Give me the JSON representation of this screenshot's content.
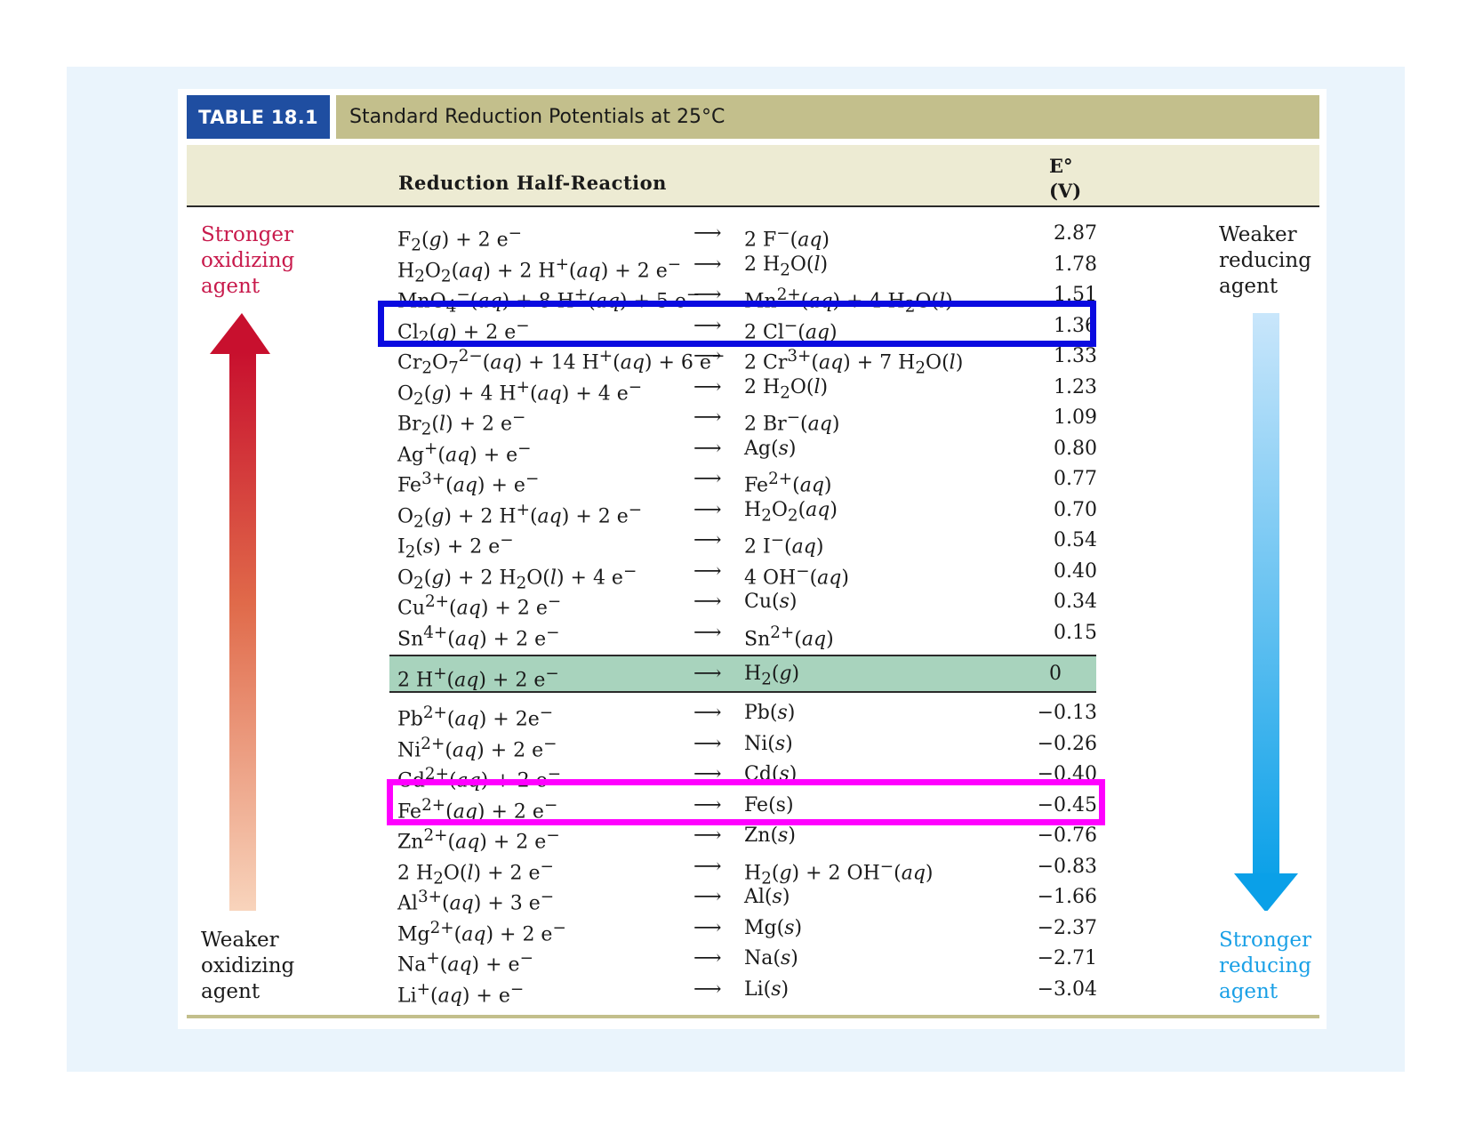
{
  "table": {
    "tag": "TABLE 18.1",
    "title": "Standard Reduction Potentials at 25°C",
    "col_reaction": "Reduction Half-Reaction",
    "col_potential_symbol": "E°",
    "col_potential_unit": "(V)"
  },
  "labels": {
    "left_top": [
      "Stronger",
      "oxidizing",
      "agent"
    ],
    "left_bottom": [
      "Weaker",
      "oxidizing",
      "agent"
    ],
    "right_top": [
      "Weaker",
      "reducing",
      "agent"
    ],
    "right_bottom": [
      "Stronger",
      "reducing",
      "agent"
    ]
  },
  "arrow_symbol": "⟶",
  "colors": {
    "outer_bg": "#eaf4fc",
    "tag_bg": "#1f4ea1",
    "title_bg": "#c3bf8c",
    "header_bg": "#edebd3",
    "hydrogen_band": "#a8d3bd",
    "highlight_blue": "#0a0ae0",
    "highlight_magenta": "#ff00ff",
    "oxidizing_arrow": "#c81a2c",
    "reducing_arrow": "#0aa0e8"
  },
  "rows": [
    {
      "reactants": "F<sub>2</sub>(<i>g</i>) + 2 e<sup>−</sup>",
      "products": "2 F<sup>−</sup>(<i>aq</i>)",
      "potential": "2.87"
    },
    {
      "reactants": "H<sub>2</sub>O<sub>2</sub>(<i>aq</i>) + 2 H<sup>+</sup>(<i>aq</i>) + 2 e<sup>−</sup>",
      "products": "2 H<sub>2</sub>O(<i>l</i>)",
      "potential": "1.78"
    },
    {
      "reactants": "MnO<sub>4</sub><sup>−</sup>(<i>aq</i>) + 8 H<sup>+</sup>(<i>aq</i>) + 5 e<sup>−</sup>",
      "products": "Mn<sup>2+</sup>(<i>aq</i>) + 4 H<sub>2</sub>O(<i>l</i>)",
      "potential": "1.51"
    },
    {
      "reactants": "Cl<sub>2</sub>(<i>g</i>) + 2 e<sup>−</sup>",
      "products": "2 Cl<sup>−</sup>(<i>aq</i>)",
      "potential": "1.36"
    },
    {
      "reactants": "Cr<sub>2</sub>O<sub>7</sub><sup>2−</sup>(<i>aq</i>) + 14 H<sup>+</sup>(<i>aq</i>) + 6 e<sup>−</sup>",
      "products": "2 Cr<sup>3+</sup>(<i>aq</i>) + 7 H<sub>2</sub>O(<i>l</i>)",
      "potential": "1.33"
    },
    {
      "reactants": "O<sub>2</sub>(<i>g</i>) + 4 H<sup>+</sup>(<i>aq</i>) + 4 e<sup>−</sup>",
      "products": "2 H<sub>2</sub>O(<i>l</i>)",
      "potential": "1.23"
    },
    {
      "reactants": "Br<sub>2</sub>(<i>l</i>) + 2 e<sup>−</sup>",
      "products": "2 Br<sup>−</sup>(<i>aq</i>)",
      "potential": "1.09"
    },
    {
      "reactants": "Ag<sup>+</sup>(<i>aq</i>) + e<sup>−</sup>",
      "products": "Ag(<i>s</i>)",
      "potential": "0.80"
    },
    {
      "reactants": "Fe<sup>3+</sup>(<i>aq</i>) + e<sup>−</sup>",
      "products": "Fe<sup>2+</sup>(<i>aq</i>)",
      "potential": "0.77"
    },
    {
      "reactants": "O<sub>2</sub>(<i>g</i>) + 2 H<sup>+</sup>(<i>aq</i>) + 2 e<sup>−</sup>",
      "products": "H<sub>2</sub>O<sub>2</sub>(<i>aq</i>)",
      "potential": "0.70"
    },
    {
      "reactants": "I<sub>2</sub>(<i>s</i>) + 2 e<sup>−</sup>",
      "products": "2 I<sup>−</sup>(<i>aq</i>)",
      "potential": "0.54"
    },
    {
      "reactants": "O<sub>2</sub>(<i>g</i>) + 2 H<sub>2</sub>O(<i>l</i>) + 4 e<sup>−</sup>",
      "products": "4 OH<sup>−</sup>(<i>aq</i>)",
      "potential": "0.40"
    },
    {
      "reactants": "Cu<sup>2+</sup>(<i>aq</i>) + 2 e<sup>−</sup>",
      "products": "Cu(<i>s</i>)",
      "potential": "0.34"
    },
    {
      "reactants": "Sn<sup>4+</sup>(<i>aq</i>) + 2 e<sup>−</sup>",
      "products": "Sn<sup>2+</sup>(<i>aq</i>)",
      "potential": "0.15"
    },
    {
      "reactants": "2 H<sup>+</sup>(<i>aq</i>) + 2 e<sup>−</sup>",
      "products": "H<sub>2</sub>(<i>g</i>)",
      "potential": "0",
      "hydrogen": true
    },
    {
      "reactants": "Pb<sup>2+</sup>(<i>aq</i>) + 2e<sup>−</sup>",
      "products": "Pb(<i>s</i>)",
      "potential": "−0.13"
    },
    {
      "reactants": "Ni<sup>2+</sup>(<i>aq</i>) + 2 e<sup>−</sup>",
      "products": "Ni(<i>s</i>)",
      "potential": "−0.26"
    },
    {
      "reactants": "Cd<sup>2+</sup>(<i>aq</i>) + 2 e<sup>−</sup>",
      "products": "Cd(<i>s</i>)",
      "potential": "−0.40"
    },
    {
      "reactants": "Fe<sup>2+</sup>(<i>aq</i>) + 2 e<sup>−</sup>",
      "products": "Fe(s)",
      "potential": "−0.45"
    },
    {
      "reactants": "Zn<sup>2+</sup>(<i>aq</i>) + 2 e<sup>−</sup>",
      "products": "Zn(<i>s</i>)",
      "potential": "−0.76"
    },
    {
      "reactants": "2 H<sub>2</sub>O(<i>l</i>) + 2 e<sup>−</sup>",
      "products": "H<sub>2</sub>(<i>g</i>) + 2 OH<sup>−</sup>(<i>aq</i>)",
      "potential": "−0.83"
    },
    {
      "reactants": "Al<sup>3+</sup>(<i>aq</i>) + 3 e<sup>−</sup>",
      "products": "Al(<i>s</i>)",
      "potential": "−1.66"
    },
    {
      "reactants": "Mg<sup>2+</sup>(<i>aq</i>) + 2 e<sup>−</sup>",
      "products": "Mg(<i>s</i>)",
      "potential": "−2.37"
    },
    {
      "reactants": "Na<sup>+</sup>(<i>aq</i>) + e<sup>−</sup>",
      "products": "Na(<i>s</i>)",
      "potential": "−2.71"
    },
    {
      "reactants": "Li<sup>+</sup>(<i>aq</i>) + e<sup>−</sup>",
      "products": "Li(<i>s</i>)",
      "potential": "−3.04"
    }
  ]
}
